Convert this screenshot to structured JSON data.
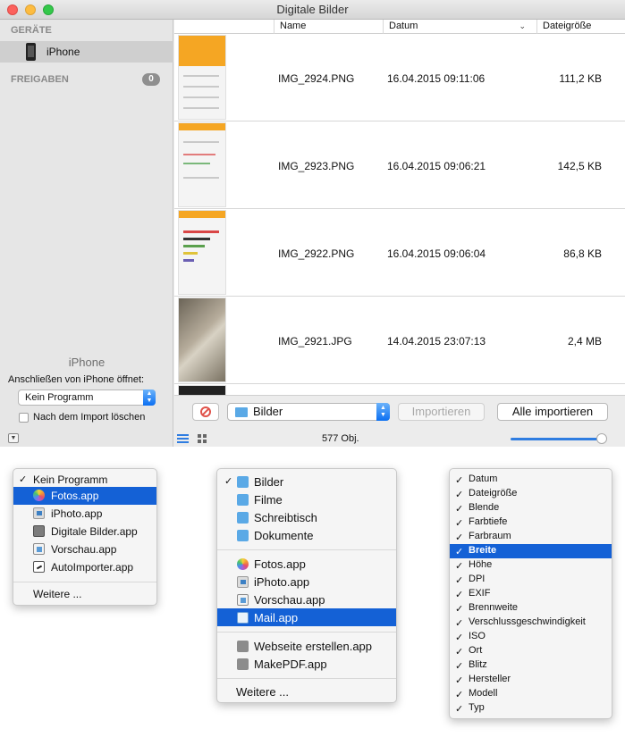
{
  "window": {
    "title": "Digitale Bilder"
  },
  "sidebar": {
    "devices_heading": "GERÄTE",
    "device_name": "iPhone",
    "shares_heading": "FREIGABEN",
    "shares_count": "0",
    "bottom_title": "iPhone",
    "connect_label": "Anschließen von iPhone öffnet:",
    "connect_value": "Kein Programm",
    "delete_after_import_label": "Nach dem Import löschen",
    "delete_after_import_checked": false
  },
  "table": {
    "columns": [
      "Name",
      "Datum",
      "Dateigröße"
    ],
    "rows": [
      {
        "name": "IMG_2924.PNG",
        "date": "16.04.2015 09:11:06",
        "size": "111,2 KB"
      },
      {
        "name": "IMG_2923.PNG",
        "date": "16.04.2015 09:06:21",
        "size": "142,5 KB"
      },
      {
        "name": "IMG_2922.PNG",
        "date": "16.04.2015 09:06:04",
        "size": "86,8 KB"
      },
      {
        "name": "IMG_2921.JPG",
        "date": "14.04.2015 23:07:13",
        "size": "2,4 MB"
      }
    ]
  },
  "toolbar": {
    "destination": "Bilder",
    "import_label": "Importieren",
    "import_all_label": "Alle importieren",
    "count": "577 Obj."
  },
  "menu_apps": {
    "items": [
      {
        "label": "Kein Programm",
        "checked": true,
        "icon": ""
      },
      {
        "label": "Fotos.app",
        "selected": true,
        "icon": "photos-icon"
      },
      {
        "label": "iPhoto.app",
        "icon": "iphoto-icon"
      },
      {
        "label": "Digitale Bilder.app",
        "icon": "image-capture-icon"
      },
      {
        "label": "Vorschau.app",
        "icon": "preview-icon"
      },
      {
        "label": "AutoImporter.app",
        "icon": "autoimporter-icon"
      }
    ],
    "more": "Weitere ..."
  },
  "menu_destination": {
    "folders": [
      {
        "label": "Bilder",
        "checked": true
      },
      {
        "label": "Filme"
      },
      {
        "label": "Schreibtisch"
      },
      {
        "label": "Dokumente"
      }
    ],
    "apps": [
      {
        "label": "Fotos.app",
        "icon": "photos-icon"
      },
      {
        "label": "iPhoto.app",
        "icon": "iphoto-icon"
      },
      {
        "label": "Vorschau.app",
        "icon": "preview-icon"
      },
      {
        "label": "Mail.app",
        "selected": true,
        "icon": "mail-icon"
      }
    ],
    "workflows": [
      {
        "label": "Webseite erstellen.app",
        "icon": "automator-icon"
      },
      {
        "label": "MakePDF.app",
        "icon": "automator-icon"
      }
    ],
    "more": "Weitere ..."
  },
  "menu_columns": {
    "items": [
      {
        "label": "Datum",
        "checked": true
      },
      {
        "label": "Dateigröße",
        "checked": true
      },
      {
        "label": "Blende",
        "checked": true
      },
      {
        "label": "Farbtiefe",
        "checked": true
      },
      {
        "label": "Farbraum",
        "checked": true
      },
      {
        "label": "Breite",
        "checked": true,
        "selected": true
      },
      {
        "label": "Höhe",
        "checked": true
      },
      {
        "label": "DPI",
        "checked": true
      },
      {
        "label": "EXIF",
        "checked": true
      },
      {
        "label": "Brennweite",
        "checked": true
      },
      {
        "label": "Verschlussgeschwindigkeit",
        "checked": true
      },
      {
        "label": "ISO",
        "checked": true
      },
      {
        "label": "Ort",
        "checked": true
      },
      {
        "label": "Blitz",
        "checked": true
      },
      {
        "label": "Hersteller",
        "checked": true
      },
      {
        "label": "Modell",
        "checked": true
      },
      {
        "label": "Typ",
        "checked": true
      }
    ]
  },
  "colors": {
    "accent": "#1461d6",
    "stop": "#e0524a"
  }
}
